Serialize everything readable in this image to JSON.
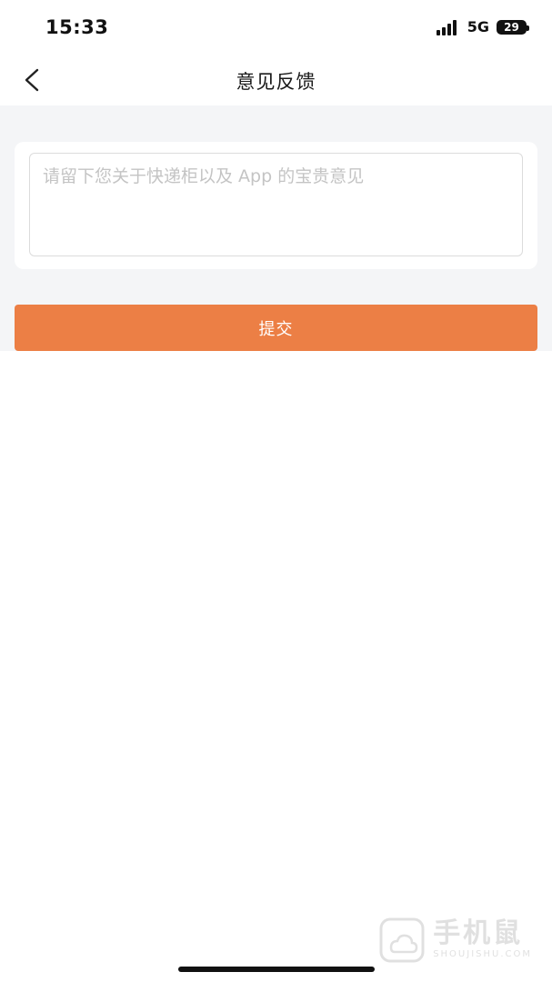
{
  "status_bar": {
    "time": "15:33",
    "network": "5G",
    "battery": "29",
    "icons": [
      "signal-icon",
      "battery-icon"
    ]
  },
  "nav": {
    "title": "意见反馈",
    "back_icon": "chevron-left-icon"
  },
  "feedback": {
    "value": "",
    "placeholder": "请留下您关于快递柜以及 App 的宝贵意见"
  },
  "submit": {
    "label": "提交",
    "color": "#ec7f45"
  },
  "watermark": {
    "main": "手机鼠",
    "sub": "SHOUJISHU.COM",
    "icon": "cloud-shield-logo-icon"
  }
}
